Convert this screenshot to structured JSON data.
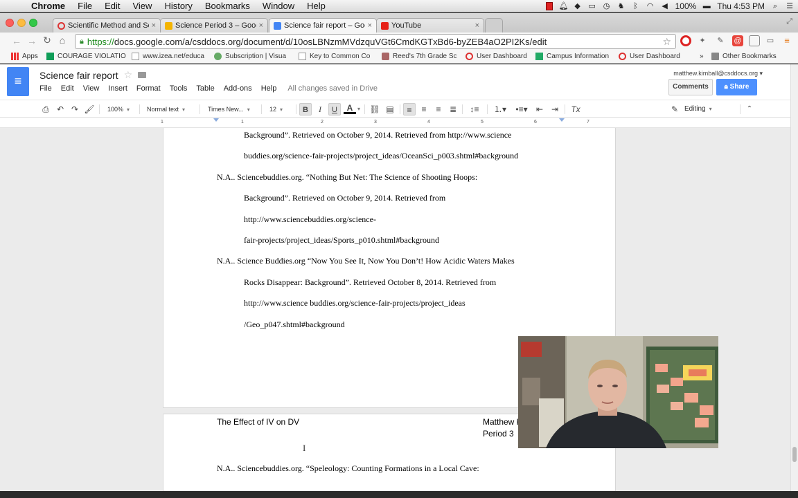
{
  "menubar": {
    "app": "Chrome",
    "items": [
      "File",
      "Edit",
      "View",
      "History",
      "Bookmarks",
      "Window",
      "Help"
    ],
    "battery": "100%",
    "clock": "Thu 4:53 PM"
  },
  "tabs": [
    {
      "title": "Scientific Method and Scie",
      "close": "×",
      "icon_color": "#d33"
    },
    {
      "title": "Science Period 3 – Google",
      "close": "×",
      "icon_color": "#f4b400"
    },
    {
      "title": "Science fair report – Googl",
      "close": "×",
      "icon_color": "#4285f4"
    },
    {
      "title": "YouTube",
      "close": "×",
      "icon_color": "#e62117"
    }
  ],
  "address": {
    "scheme": "https://",
    "host_path": "docs.google.com/a/csddocs.org/document/d/10osLBNzmMVdzquVGt6CmdKGTxBd6-byZEB4aO2PI2Ks/edit"
  },
  "bookmarks": [
    {
      "label": "Apps",
      "icon": "apps-icon",
      "color": "#555"
    },
    {
      "label": "COURAGE VIOLATIO",
      "icon": "sheet-icon",
      "color": "#0f9d58"
    },
    {
      "label": "www.izea.net/educa",
      "icon": "page-icon",
      "color": "#999"
    },
    {
      "label": "Subscription | Visua",
      "icon": "globe-icon",
      "color": "#6a6"
    },
    {
      "label": "Key to Common Co",
      "icon": "page-icon",
      "color": "#999"
    },
    {
      "label": "Reed's 7th Grade Sc",
      "icon": "puzzle-icon",
      "color": "#a66"
    },
    {
      "label": "User Dashboard",
      "icon": "ring-icon",
      "color": "#d33"
    },
    {
      "label": "Campus Information",
      "icon": "campus-icon",
      "color": "#2a6"
    },
    {
      "label": "User Dashboard",
      "icon": "ring-icon",
      "color": "#d33"
    },
    {
      "label": "»",
      "icon": "",
      "color": ""
    },
    {
      "label": "Other Bookmarks",
      "icon": "folder-icon",
      "color": "#888"
    }
  ],
  "docs": {
    "title": "Science fair report",
    "menu": [
      "File",
      "Edit",
      "View",
      "Insert",
      "Format",
      "Tools",
      "Table",
      "Add-ons",
      "Help"
    ],
    "save_status": "All changes saved in Drive",
    "account": "matthew.kimball@csddocs.org",
    "comments_label": "Comments",
    "share_label": "Share",
    "toolbar": {
      "zoom": "100%",
      "style": "Normal text",
      "font": "Times New...",
      "size": "12",
      "bold": "B",
      "italic": "I",
      "underline": "U",
      "text_color": "A",
      "clear": "Tx",
      "mode": "Editing"
    },
    "ruler_numbers": [
      "1",
      "1",
      "2",
      "3",
      "4",
      "5",
      "6",
      "7"
    ]
  },
  "page1_lines": [
    "Background”. Retrieved on October 9, 2014. Retrieved from http://www.science",
    "buddies.org/science-fair-projects/project_ideas/OceanSci_p003.shtml#background",
    "N.A.. Sciencebuddies.org. “Nothing But Net: The Science of Shooting Hoops:",
    "Background”. Retrieved on October 9, 2014. Retrieved from",
    "http://www.sciencebuddies.org/science-",
    "fair-projects/project_ideas/Sports_p010.shtml#background",
    "N.A.. Science Buddies.org “Now You See It, Now You Don’t! How Acidic Waters Makes",
    "Rocks Disappear: Background”. Retrieved October 8, 2014. Retrieved from",
    "http://www.science buddies.org/science-fair-projects/project_ideas",
    "/Geo_p047.shtml#background"
  ],
  "page2": {
    "header_left": "The Effect of IV on DV",
    "header_right_1": "Matthew K",
    "header_right_2": "Period 3",
    "first_line": "N.A.. Sciencebuddies.org. “Speleology: Counting Formations in a Local Cave:"
  }
}
